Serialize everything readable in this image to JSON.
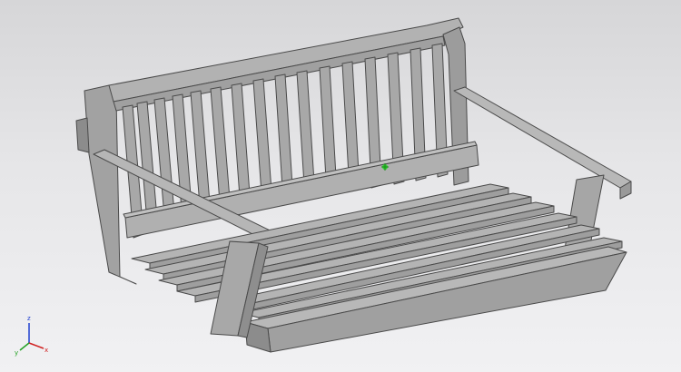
{
  "viewport": {
    "background_top": "#d6d6d8",
    "background_bottom": "#f1f1f3"
  },
  "model": {
    "subject": "porch-swing-bench",
    "shade_light": "#b4b4b4",
    "shade_mid": "#a4a4a4",
    "shade_dark": "#8a8a8a",
    "edge": "#4a4a4a"
  },
  "axis_triad": {
    "x_label": "x",
    "y_label": "y",
    "z_label": "z",
    "x_color": "#d02020",
    "y_color": "#20a020",
    "z_color": "#2040d0"
  },
  "origin_marker": {
    "color": "#2fd02f"
  }
}
